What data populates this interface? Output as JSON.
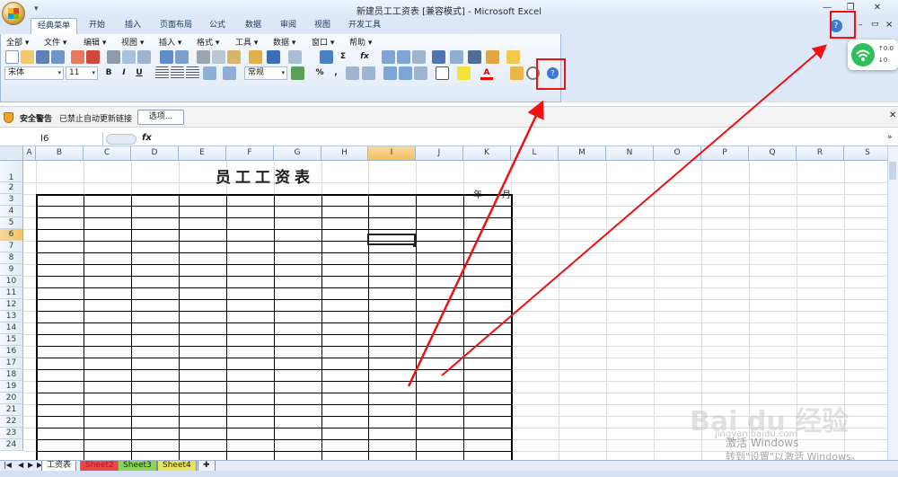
{
  "window": {
    "title": "新建员工工资表  [兼容模式] - Microsoft Excel",
    "minimize_icon": "minimize-icon",
    "restore_icon": "restore-icon",
    "close_icon": "close-icon"
  },
  "ribbon_tabs": [
    "经典菜单",
    "开始",
    "插入",
    "页面布局",
    "公式",
    "数据",
    "审阅",
    "视图",
    "开发工具"
  ],
  "classic_menu": [
    "全部",
    "文件",
    "编辑",
    "视图",
    "插入",
    "格式",
    "工具",
    "数据",
    "窗口",
    "帮助"
  ],
  "toolbar": {
    "font_name": "宋体",
    "font_size": "11",
    "bold": "B",
    "italic": "I",
    "underline": "U",
    "number_format": "常规",
    "percent": "%",
    "comma": ",",
    "sigma": "Σ",
    "fx": "fx",
    "font_color_label": "A"
  },
  "security_bar": {
    "title": "安全警告",
    "message": "已禁止自动更新链接",
    "options_label": "选项..."
  },
  "formula_bar": {
    "name_box": "I6",
    "fx_label": "fx",
    "value": ""
  },
  "columns": [
    "A",
    "B",
    "C",
    "D",
    "E",
    "F",
    "G",
    "H",
    "I",
    "J",
    "K",
    "L",
    "M",
    "N",
    "O",
    "P",
    "Q",
    "R",
    "S"
  ],
  "active_column": "I",
  "rows": [
    "1",
    "2",
    "3",
    "4",
    "5",
    "6",
    "7",
    "8",
    "9",
    "10",
    "11",
    "12",
    "13",
    "14",
    "15",
    "16",
    "17",
    "18",
    "19",
    "20",
    "21",
    "22",
    "23",
    "24"
  ],
  "active_row": "6",
  "sheet": {
    "title": "员工工资表",
    "year_label": "年",
    "month_label": "月"
  },
  "sheet_tabs": [
    {
      "label": "工资表",
      "color": "#ffffff",
      "active": true
    },
    {
      "label": "Sheet2",
      "color": "#e8474b",
      "active": false
    },
    {
      "label": "Sheet3",
      "color": "#8cd35a",
      "active": false
    },
    {
      "label": "Sheet4",
      "color": "#e6e45a",
      "active": false
    }
  ],
  "wifi_widget": {
    "up": "0.0",
    "down": "0",
    "icon": "wifi-icon"
  },
  "watermark": {
    "brand": "Bai du 经验",
    "sub": "jingyan.baidu.com"
  },
  "activation": {
    "line1": "激活 Windows",
    "line2": "转到\"设置\"以激活 Windows。"
  },
  "colors": {
    "ribbon_bg": "#dce8f7",
    "highlight": "#f01010",
    "active_header": "#f1c15f"
  }
}
